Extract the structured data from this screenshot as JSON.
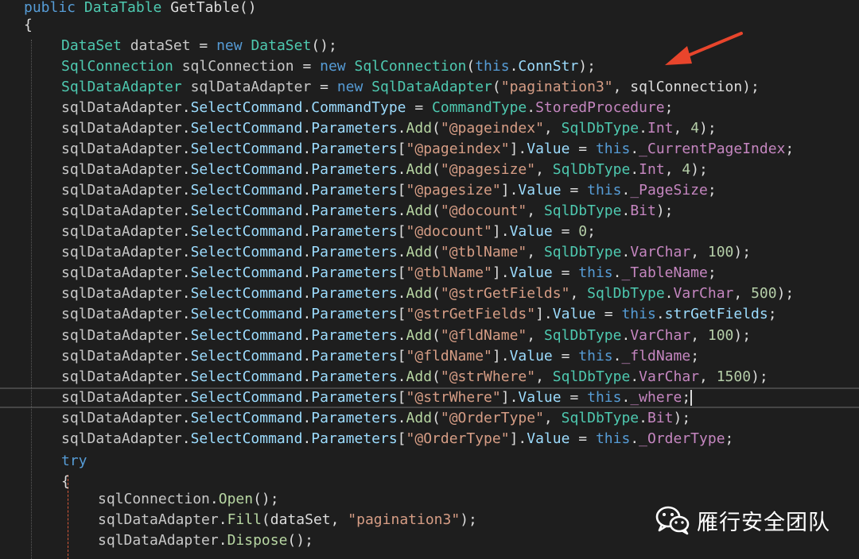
{
  "editor": {
    "language": "csharp",
    "theme_colors": {
      "background": "#1e1e1e",
      "keyword": "#569cd6",
      "type": "#4ec9b0",
      "string": "#d69d85",
      "number": "#b5cea8",
      "property": "#9cdcfe",
      "private_field": "#c586c0",
      "arrow": "#e8452c"
    },
    "lines": [
      [
        [
          "kw",
          "public "
        ],
        [
          "ty",
          "DataTable "
        ],
        [
          "pu",
          "GetTable()"
        ]
      ],
      [
        [
          "pu",
          "{"
        ]
      ],
      [
        [
          "ty",
          "DataSet "
        ],
        [
          "va",
          "dataSet "
        ],
        [
          "pu",
          "= "
        ],
        [
          "kw",
          "new "
        ],
        [
          "ty",
          "DataSet"
        ],
        [
          "pu",
          "();"
        ]
      ],
      [
        [
          "ty",
          "SqlConnection "
        ],
        [
          "va",
          "sqlConnection "
        ],
        [
          "pu",
          "= "
        ],
        [
          "kw",
          "new "
        ],
        [
          "ty",
          "SqlConnection"
        ],
        [
          "pu",
          "("
        ],
        [
          "kw",
          "this"
        ],
        [
          "pu",
          "."
        ],
        [
          "pr",
          "ConnStr"
        ],
        [
          "pu",
          ");"
        ]
      ],
      [
        [
          "ty",
          "SqlDataAdapter "
        ],
        [
          "va",
          "sqlDataAdapter "
        ],
        [
          "pu",
          "= "
        ],
        [
          "kw",
          "new "
        ],
        [
          "ty",
          "SqlDataAdapter"
        ],
        [
          "pu",
          "("
        ],
        [
          "st",
          "\"pagination3\""
        ],
        [
          "pu",
          ", sqlConnection);"
        ]
      ],
      [
        [
          "va",
          "sqlDataAdapter"
        ],
        [
          "pu",
          "."
        ],
        [
          "pr",
          "SelectCommand"
        ],
        [
          "pu",
          "."
        ],
        [
          "pr",
          "CommandType"
        ],
        [
          "pu",
          " = "
        ],
        [
          "ty",
          "CommandType"
        ],
        [
          "pu",
          "."
        ],
        [
          "pp",
          "StoredProcedure"
        ],
        [
          "pu",
          ";"
        ]
      ],
      [
        [
          "va",
          "sqlDataAdapter"
        ],
        [
          "pu",
          "."
        ],
        [
          "pr",
          "SelectCommand"
        ],
        [
          "pu",
          "."
        ],
        [
          "pr",
          "Parameters"
        ],
        [
          "pu",
          "."
        ],
        [
          "mt",
          "Add"
        ],
        [
          "pu",
          "("
        ],
        [
          "st",
          "\"@pageindex\""
        ],
        [
          "pu",
          ", "
        ],
        [
          "ty",
          "SqlDbType"
        ],
        [
          "pu",
          "."
        ],
        [
          "pp",
          "Int"
        ],
        [
          "pu",
          ", "
        ],
        [
          "nm",
          "4"
        ],
        [
          "pu",
          ");"
        ]
      ],
      [
        [
          "va",
          "sqlDataAdapter"
        ],
        [
          "pu",
          "."
        ],
        [
          "pr",
          "SelectCommand"
        ],
        [
          "pu",
          "."
        ],
        [
          "pr",
          "Parameters"
        ],
        [
          "pu",
          "["
        ],
        [
          "st",
          "\"@pageindex\""
        ],
        [
          "pu",
          "]."
        ],
        [
          "pr",
          "Value"
        ],
        [
          "pu",
          " = "
        ],
        [
          "kw",
          "this"
        ],
        [
          "pu",
          "."
        ],
        [
          "pp",
          "_CurrentPageIndex"
        ],
        [
          "pu",
          ";"
        ]
      ],
      [
        [
          "va",
          "sqlDataAdapter"
        ],
        [
          "pu",
          "."
        ],
        [
          "pr",
          "SelectCommand"
        ],
        [
          "pu",
          "."
        ],
        [
          "pr",
          "Parameters"
        ],
        [
          "pu",
          "."
        ],
        [
          "mt",
          "Add"
        ],
        [
          "pu",
          "("
        ],
        [
          "st",
          "\"@pagesize\""
        ],
        [
          "pu",
          ", "
        ],
        [
          "ty",
          "SqlDbType"
        ],
        [
          "pu",
          "."
        ],
        [
          "pp",
          "Int"
        ],
        [
          "pu",
          ", "
        ],
        [
          "nm",
          "4"
        ],
        [
          "pu",
          ");"
        ]
      ],
      [
        [
          "va",
          "sqlDataAdapter"
        ],
        [
          "pu",
          "."
        ],
        [
          "pr",
          "SelectCommand"
        ],
        [
          "pu",
          "."
        ],
        [
          "pr",
          "Parameters"
        ],
        [
          "pu",
          "["
        ],
        [
          "st",
          "\"@pagesize\""
        ],
        [
          "pu",
          "]."
        ],
        [
          "pr",
          "Value"
        ],
        [
          "pu",
          " = "
        ],
        [
          "kw",
          "this"
        ],
        [
          "pu",
          "."
        ],
        [
          "pp",
          "_PageSize"
        ],
        [
          "pu",
          ";"
        ]
      ],
      [
        [
          "va",
          "sqlDataAdapter"
        ],
        [
          "pu",
          "."
        ],
        [
          "pr",
          "SelectCommand"
        ],
        [
          "pu",
          "."
        ],
        [
          "pr",
          "Parameters"
        ],
        [
          "pu",
          "."
        ],
        [
          "mt",
          "Add"
        ],
        [
          "pu",
          "("
        ],
        [
          "st",
          "\"@docount\""
        ],
        [
          "pu",
          ", "
        ],
        [
          "ty",
          "SqlDbType"
        ],
        [
          "pu",
          "."
        ],
        [
          "pp",
          "Bit"
        ],
        [
          "pu",
          ");"
        ]
      ],
      [
        [
          "va",
          "sqlDataAdapter"
        ],
        [
          "pu",
          "."
        ],
        [
          "pr",
          "SelectCommand"
        ],
        [
          "pu",
          "."
        ],
        [
          "pr",
          "Parameters"
        ],
        [
          "pu",
          "["
        ],
        [
          "st",
          "\"@docount\""
        ],
        [
          "pu",
          "]."
        ],
        [
          "pr",
          "Value"
        ],
        [
          "pu",
          " = "
        ],
        [
          "nm",
          "0"
        ],
        [
          "pu",
          ";"
        ]
      ],
      [
        [
          "va",
          "sqlDataAdapter"
        ],
        [
          "pu",
          "."
        ],
        [
          "pr",
          "SelectCommand"
        ],
        [
          "pu",
          "."
        ],
        [
          "pr",
          "Parameters"
        ],
        [
          "pu",
          "."
        ],
        [
          "mt",
          "Add"
        ],
        [
          "pu",
          "("
        ],
        [
          "st",
          "\"@tblName\""
        ],
        [
          "pu",
          ", "
        ],
        [
          "ty",
          "SqlDbType"
        ],
        [
          "pu",
          "."
        ],
        [
          "pp",
          "VarChar"
        ],
        [
          "pu",
          ", "
        ],
        [
          "nm",
          "100"
        ],
        [
          "pu",
          ");"
        ]
      ],
      [
        [
          "va",
          "sqlDataAdapter"
        ],
        [
          "pu",
          "."
        ],
        [
          "pr",
          "SelectCommand"
        ],
        [
          "pu",
          "."
        ],
        [
          "pr",
          "Parameters"
        ],
        [
          "pu",
          "["
        ],
        [
          "st",
          "\"@tblName\""
        ],
        [
          "pu",
          "]."
        ],
        [
          "pr",
          "Value"
        ],
        [
          "pu",
          " = "
        ],
        [
          "kw",
          "this"
        ],
        [
          "pu",
          "."
        ],
        [
          "pp",
          "_TableName"
        ],
        [
          "pu",
          ";"
        ]
      ],
      [
        [
          "va",
          "sqlDataAdapter"
        ],
        [
          "pu",
          "."
        ],
        [
          "pr",
          "SelectCommand"
        ],
        [
          "pu",
          "."
        ],
        [
          "pr",
          "Parameters"
        ],
        [
          "pu",
          "."
        ],
        [
          "mt",
          "Add"
        ],
        [
          "pu",
          "("
        ],
        [
          "st",
          "\"@strGetFields\""
        ],
        [
          "pu",
          ", "
        ],
        [
          "ty",
          "SqlDbType"
        ],
        [
          "pu",
          "."
        ],
        [
          "pp",
          "VarChar"
        ],
        [
          "pu",
          ", "
        ],
        [
          "nm",
          "500"
        ],
        [
          "pu",
          ");"
        ]
      ],
      [
        [
          "va",
          "sqlDataAdapter"
        ],
        [
          "pu",
          "."
        ],
        [
          "pr",
          "SelectCommand"
        ],
        [
          "pu",
          "."
        ],
        [
          "pr",
          "Parameters"
        ],
        [
          "pu",
          "["
        ],
        [
          "st",
          "\"@strGetFields\""
        ],
        [
          "pu",
          "]."
        ],
        [
          "pr",
          "Value"
        ],
        [
          "pu",
          " = "
        ],
        [
          "kw",
          "this"
        ],
        [
          "pu",
          "."
        ],
        [
          "pr",
          "strGetFields"
        ],
        [
          "pu",
          ";"
        ]
      ],
      [
        [
          "va",
          "sqlDataAdapter"
        ],
        [
          "pu",
          "."
        ],
        [
          "pr",
          "SelectCommand"
        ],
        [
          "pu",
          "."
        ],
        [
          "pr",
          "Parameters"
        ],
        [
          "pu",
          "."
        ],
        [
          "mt",
          "Add"
        ],
        [
          "pu",
          "("
        ],
        [
          "st",
          "\"@fldName\""
        ],
        [
          "pu",
          ", "
        ],
        [
          "ty",
          "SqlDbType"
        ],
        [
          "pu",
          "."
        ],
        [
          "pp",
          "VarChar"
        ],
        [
          "pu",
          ", "
        ],
        [
          "nm",
          "100"
        ],
        [
          "pu",
          ");"
        ]
      ],
      [
        [
          "va",
          "sqlDataAdapter"
        ],
        [
          "pu",
          "."
        ],
        [
          "pr",
          "SelectCommand"
        ],
        [
          "pu",
          "."
        ],
        [
          "pr",
          "Parameters"
        ],
        [
          "pu",
          "["
        ],
        [
          "st",
          "\"@fldName\""
        ],
        [
          "pu",
          "]."
        ],
        [
          "pr",
          "Value"
        ],
        [
          "pu",
          " = "
        ],
        [
          "kw",
          "this"
        ],
        [
          "pu",
          "."
        ],
        [
          "pp",
          "_fldName"
        ],
        [
          "pu",
          ";"
        ]
      ],
      [
        [
          "va",
          "sqlDataAdapter"
        ],
        [
          "pu",
          "."
        ],
        [
          "pr",
          "SelectCommand"
        ],
        [
          "pu",
          "."
        ],
        [
          "pr",
          "Parameters"
        ],
        [
          "pu",
          "."
        ],
        [
          "mt",
          "Add"
        ],
        [
          "pu",
          "("
        ],
        [
          "st",
          "\"@strWhere\""
        ],
        [
          "pu",
          ", "
        ],
        [
          "ty",
          "SqlDbType"
        ],
        [
          "pu",
          "."
        ],
        [
          "pp",
          "VarChar"
        ],
        [
          "pu",
          ", "
        ],
        [
          "nm",
          "1500"
        ],
        [
          "pu",
          ");"
        ]
      ],
      [
        [
          "va",
          "sqlDataAdapter"
        ],
        [
          "pu",
          "."
        ],
        [
          "pr",
          "SelectCommand"
        ],
        [
          "pu",
          "."
        ],
        [
          "pr",
          "Parameters"
        ],
        [
          "pu",
          "["
        ],
        [
          "st",
          "\"@strWhere\""
        ],
        [
          "pu",
          "]."
        ],
        [
          "pr",
          "Value"
        ],
        [
          "pu",
          " = "
        ],
        [
          "kw",
          "this"
        ],
        [
          "pu",
          "."
        ],
        [
          "pp",
          "_where"
        ],
        [
          "pu",
          ";"
        ]
      ],
      [
        [
          "va",
          "sqlDataAdapter"
        ],
        [
          "pu",
          "."
        ],
        [
          "pr",
          "SelectCommand"
        ],
        [
          "pu",
          "."
        ],
        [
          "pr",
          "Parameters"
        ],
        [
          "pu",
          "."
        ],
        [
          "mt",
          "Add"
        ],
        [
          "pu",
          "("
        ],
        [
          "st",
          "\"@OrderType\""
        ],
        [
          "pu",
          ", "
        ],
        [
          "ty",
          "SqlDbType"
        ],
        [
          "pu",
          "."
        ],
        [
          "pp",
          "Bit"
        ],
        [
          "pu",
          ");"
        ]
      ],
      [
        [
          "va",
          "sqlDataAdapter"
        ],
        [
          "pu",
          "."
        ],
        [
          "pr",
          "SelectCommand"
        ],
        [
          "pu",
          "."
        ],
        [
          "pr",
          "Parameters"
        ],
        [
          "pu",
          "["
        ],
        [
          "st",
          "\"@OrderType\""
        ],
        [
          "pu",
          "]."
        ],
        [
          "pr",
          "Value"
        ],
        [
          "pu",
          " = "
        ],
        [
          "kw",
          "this"
        ],
        [
          "pu",
          "."
        ],
        [
          "pp",
          "_OrderType"
        ],
        [
          "pu",
          ";"
        ]
      ],
      [
        [
          "kw",
          "try"
        ]
      ],
      [
        [
          "pu",
          "{"
        ]
      ],
      [
        [
          "va",
          "sqlConnection"
        ],
        [
          "pu",
          "."
        ],
        [
          "mt",
          "Open"
        ],
        [
          "pu",
          "();"
        ]
      ],
      [
        [
          "va",
          "sqlDataAdapter"
        ],
        [
          "pu",
          "."
        ],
        [
          "mt",
          "Fill"
        ],
        [
          "pu",
          "(dataSet, "
        ],
        [
          "st",
          "\"pagination3\""
        ],
        [
          "pu",
          ");"
        ]
      ],
      [
        [
          "va",
          "sqlDataAdapter"
        ],
        [
          "pu",
          "."
        ],
        [
          "mt",
          "Dispose"
        ],
        [
          "pu",
          "();"
        ]
      ]
    ],
    "cursor_line": 19
  },
  "watermark": {
    "text": "雁行安全团队",
    "icon": "wechat-icon"
  }
}
